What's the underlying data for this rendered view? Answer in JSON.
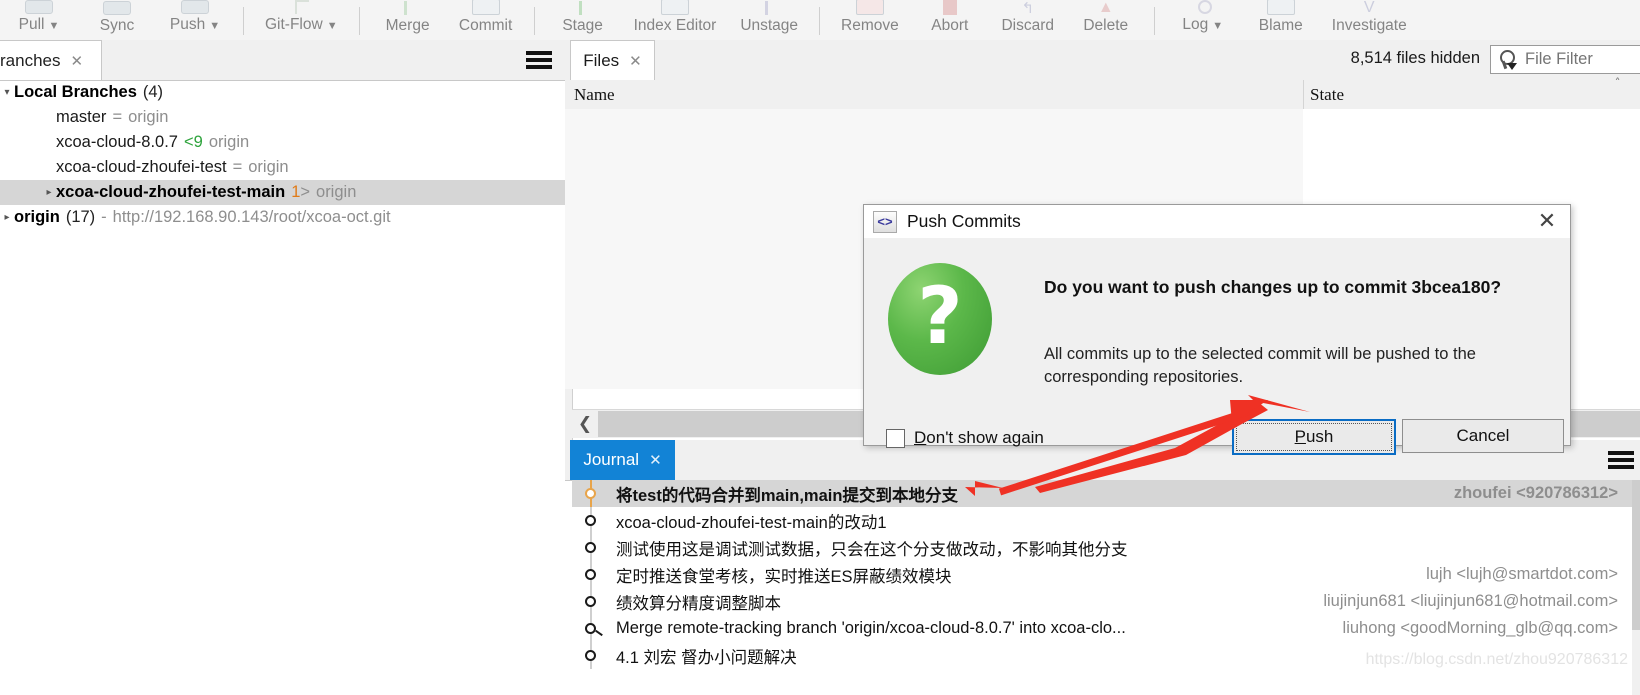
{
  "toolbar": {
    "items": [
      {
        "label": "Pull",
        "icon": "pull-icon",
        "dropdown": true
      },
      {
        "label": "Sync",
        "icon": "sync-icon",
        "dropdown": false
      },
      {
        "label": "Push",
        "icon": "push-icon",
        "dropdown": true
      },
      {
        "label": "Git-Flow",
        "icon": "git-flow-icon",
        "dropdown": true
      },
      {
        "label": "Merge",
        "icon": "merge-icon",
        "dropdown": false
      },
      {
        "label": "Commit",
        "icon": "commit-icon",
        "dropdown": false
      },
      {
        "label": "Stage",
        "icon": "stage-icon",
        "dropdown": false
      },
      {
        "label": "Index Editor",
        "icon": "index-editor-icon",
        "dropdown": false
      },
      {
        "label": "Unstage",
        "icon": "unstage-icon",
        "dropdown": false
      },
      {
        "label": "Remove",
        "icon": "remove-icon",
        "dropdown": false
      },
      {
        "label": "Abort",
        "icon": "abort-icon",
        "dropdown": false
      },
      {
        "label": "Discard",
        "icon": "discard-icon",
        "dropdown": false
      },
      {
        "label": "Delete",
        "icon": "delete-icon",
        "dropdown": false
      },
      {
        "label": "Log",
        "icon": "log-icon",
        "dropdown": true
      },
      {
        "label": "Blame",
        "icon": "blame-icon",
        "dropdown": false
      },
      {
        "label": "Investigate",
        "icon": "investigate-icon",
        "dropdown": false
      }
    ]
  },
  "branches_panel": {
    "tab_label": "ranches",
    "menu_icon": "hamburger-icon",
    "groups": [
      {
        "label": "Local Branches",
        "count": "(4)",
        "expanded": true,
        "children": [
          {
            "name": "master",
            "tracking_sep": "=",
            "ahead": "",
            "remote": "origin",
            "selected": false,
            "bold": false
          },
          {
            "name": "xcoa-cloud-8.0.7",
            "tracking_sep": "<",
            "ahead": "9",
            "remote": "origin",
            "selected": false,
            "bold": false,
            "ahead_color": "green"
          },
          {
            "name": "xcoa-cloud-zhoufei-test",
            "tracking_sep": "=",
            "ahead": "",
            "remote": "origin",
            "selected": false,
            "bold": false
          },
          {
            "name": "xcoa-cloud-zhoufei-test-main",
            "tracking_sep": ">",
            "ahead": "1",
            "remote": "origin",
            "selected": true,
            "bold": true,
            "ahead_color": "orange"
          }
        ]
      }
    ],
    "remote": {
      "label": "origin",
      "count": "(17)",
      "dash": "-",
      "url": "http://192.168.90.143/root/xcoa-oct.git"
    }
  },
  "files_panel": {
    "tab_label": "Files",
    "hidden_count_text": "8,514 files hidden",
    "filter": {
      "placeholder": "File Filter",
      "value": "",
      "icon": "search-icon",
      "clear_icon": "clear-icon"
    },
    "toolbar_icons": [
      {
        "name": "open-folder-icon",
        "highlighted": true
      },
      {
        "name": "blank-file-icon",
        "highlighted": false
      },
      {
        "name": "new-file-icon",
        "highlighted": true
      },
      {
        "name": "modified-file-icon",
        "highlighted": true
      },
      {
        "name": "unchanged-file-icon",
        "highlighted": false
      },
      {
        "name": "conflicted-file-icon",
        "highlighted": false
      },
      {
        "name": "deleted-file-icon",
        "highlighted": false
      },
      {
        "name": "staged-files-icon",
        "highlighted": true
      },
      {
        "name": "ignored-file-icon",
        "highlighted": false
      }
    ],
    "columns": [
      "Name",
      "State"
    ],
    "rows": []
  },
  "journal_panel": {
    "tab_label": "Journal",
    "menu_icon": "hamburger-icon",
    "rows": [
      {
        "message": "将test的代码合并到main,main提交到本地分支",
        "author": "zhoufei <920786312>",
        "selected": true,
        "node": "open"
      },
      {
        "message": "xcoa-cloud-zhoufei-test-main的改动1",
        "author": "",
        "selected": false,
        "node": "normal"
      },
      {
        "message": "测试使用这是调试测试数据，只会在这个分支做改动，不影响其他分支",
        "author": "",
        "selected": false,
        "node": "normal"
      },
      {
        "message": "定时推送食堂考核，实时推送ES屏蔽绩效模块",
        "author": "lujh <lujh@smartdot.com>",
        "selected": false,
        "node": "normal"
      },
      {
        "message": "绩效算分精度调整脚本",
        "author": "liujinjun681 <liujinjun681@hotmail.com>",
        "selected": false,
        "node": "normal"
      },
      {
        "message": "Merge remote-tracking branch 'origin/xcoa-cloud-8.0.7' into xcoa-clo...",
        "author": "liuhong <goodMorning_glb@qq.com>",
        "selected": false,
        "node": "merge"
      },
      {
        "message": "4.1 刘宏 督办小问题解决",
        "author": "",
        "selected": false,
        "node": "normal"
      }
    ],
    "watermark": "https://blog.csdn.net/zhou920786312"
  },
  "dialog": {
    "title": "Push Commits",
    "title_icon": "code-brackets-icon",
    "close_icon": "close-icon",
    "status_icon": "question-mark-icon",
    "heading": "Do you want to push changes up to commit 3bcea180?",
    "body": "All commits up to the selected commit will be pushed to the corresponding repositories.",
    "checkbox_label_pre": "D",
    "checkbox_label_post": "on't show again",
    "buttons": {
      "push_pre": "P",
      "push_post": "ush",
      "cancel": "Cancel"
    }
  },
  "colors": {
    "accent": "#1283d6",
    "dialog_focus": "#0a6cc4",
    "green": "#2ea33c",
    "orange": "#e07b17",
    "annotation_red": "#ef3124"
  }
}
